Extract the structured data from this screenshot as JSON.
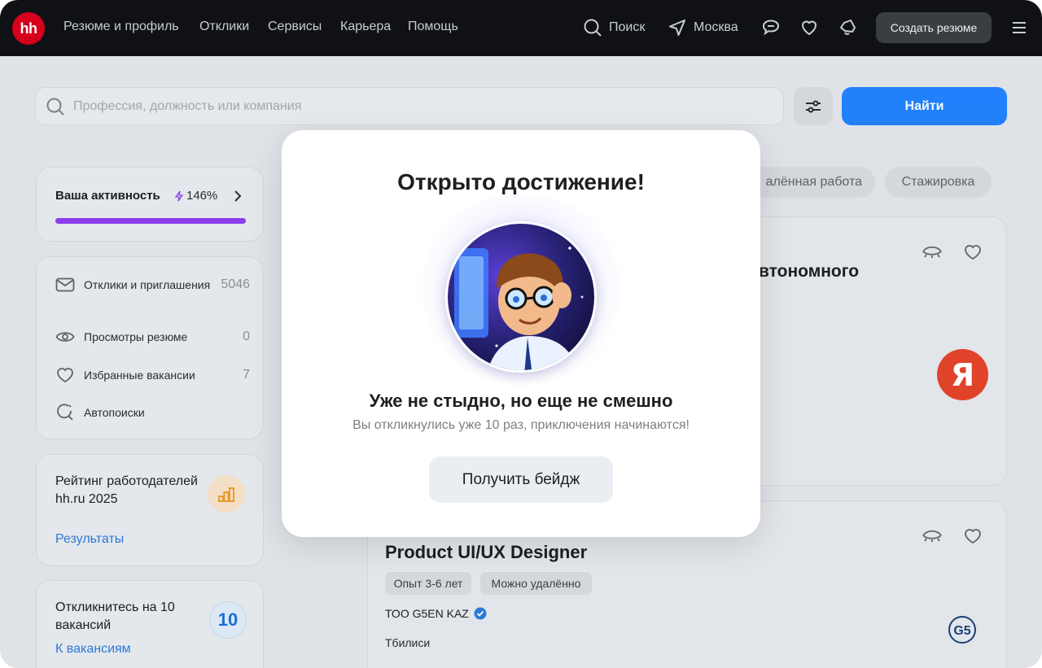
{
  "topbar": {
    "logo_text": "hh",
    "nav": [
      "Резюме и профиль",
      "Отклики",
      "Сервисы",
      "Карьера",
      "Помощь"
    ],
    "search_label": "Поиск",
    "city_label": "Москва",
    "create_resume_label": "Создать резюме"
  },
  "search": {
    "placeholder": "Профессия, должность или компания",
    "find_label": "Найти"
  },
  "activity": {
    "label": "Ваша активность",
    "percent": "146%",
    "progress": 1.0
  },
  "stats": [
    {
      "icon": "mail-icon",
      "label": "Отклики и приглашения",
      "count": "5046"
    },
    {
      "icon": "eye-icon",
      "label": "Просмотры резюме",
      "count": "0"
    },
    {
      "icon": "heart-icon",
      "label": "Избранные вакансии",
      "count": "7"
    },
    {
      "icon": "autosearch-icon",
      "label": "Автопоиски",
      "count": ""
    }
  ],
  "rating": {
    "title": "Рейтинг работодателей hh.ru 2025",
    "link": "Результаты"
  },
  "respond": {
    "title": "Откликнитесь на 10 вакансий",
    "count": "10",
    "link": "К вакансиям"
  },
  "chips": [
    "алённая работа",
    "Стажировка"
  ],
  "vacancies": [
    {
      "title_fragment": "втономного"
    },
    {
      "title": "Product UI/UX Designer",
      "tags": [
        "Опыт 3-6 лет",
        "Можно удалённо"
      ],
      "company": "ТОО G5EN KAZ",
      "city": "Тбилиси",
      "logo_text": "G5"
    }
  ],
  "yandex_logo": "Я",
  "modal": {
    "title": "Открыто достижение!",
    "subtitle": "Уже не стыдно, но еще не смешно",
    "description": "Вы откликнулись уже 10 раз, приключения начинаются!",
    "button": "Получить бейдж"
  },
  "colors": {
    "accent_blue": "#0070ff",
    "progress_purple": "#8a3dea",
    "brand_red": "#d6001c"
  }
}
